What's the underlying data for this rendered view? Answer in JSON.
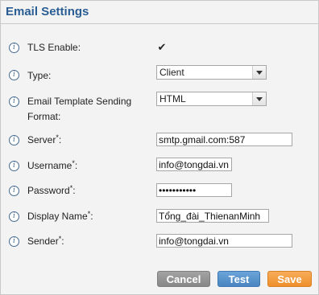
{
  "page": {
    "title": "Email Settings"
  },
  "fields": {
    "tls": {
      "label": "TLS Enable:",
      "checked": true
    },
    "type": {
      "label": "Type:",
      "value": "Client"
    },
    "template": {
      "label_line1": "Email Template Sending",
      "label_line2": "Format:",
      "value": "HTML"
    },
    "server": {
      "label": "Server",
      "required_mark": "*",
      "suffix": ":",
      "value": "smtp.gmail.com:587"
    },
    "username": {
      "label": "Username",
      "required_mark": "*",
      "suffix": ":",
      "value": "info@tongdai.vn"
    },
    "password": {
      "label": "Password",
      "required_mark": "*",
      "suffix": ":",
      "value": "•••••••••••"
    },
    "display_name": {
      "label": "Display Name",
      "required_mark": "*",
      "suffix": ":",
      "value": "Tổng_đài_ThienanMinh"
    },
    "sender": {
      "label": "Sender",
      "required_mark": "*",
      "suffix": ":",
      "value": "info@tongdai.vn"
    }
  },
  "buttons": {
    "cancel": "Cancel",
    "test": "Test",
    "save": "Save"
  },
  "colors": {
    "title": "#2a5d93",
    "cancel": "#999999",
    "test": "#5a95cf",
    "save": "#f29b3d"
  },
  "icons": {
    "info": "info-circle-icon",
    "check": "checkmark-icon",
    "dropdown": "chevron-down-icon"
  }
}
